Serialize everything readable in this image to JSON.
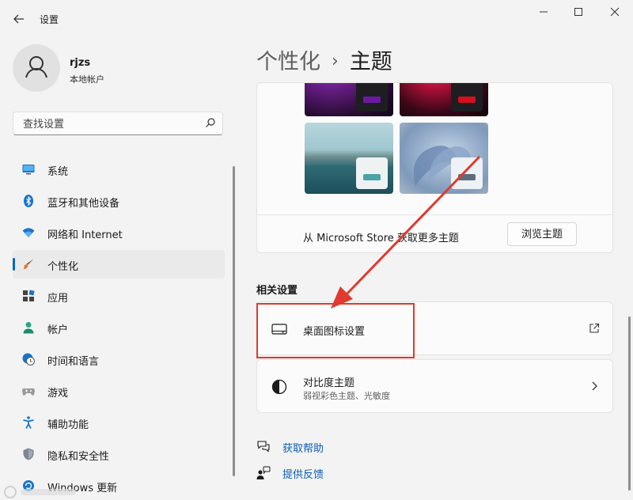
{
  "window": {
    "title": "设置",
    "controls": {
      "minimize": "—",
      "maximize": "☐",
      "close": "✕"
    }
  },
  "profile": {
    "username": "rjzs",
    "account_type": "本地帐户"
  },
  "search": {
    "placeholder": "查找设置"
  },
  "sidebar": {
    "items": [
      {
        "label": "系统",
        "icon": "monitor-icon"
      },
      {
        "label": "蓝牙和其他设备",
        "icon": "bluetooth-icon"
      },
      {
        "label": "网络和 Internet",
        "icon": "wifi-icon"
      },
      {
        "label": "个性化",
        "icon": "brush-icon",
        "selected": true
      },
      {
        "label": "应用",
        "icon": "apps-icon"
      },
      {
        "label": "帐户",
        "icon": "person-icon"
      },
      {
        "label": "时间和语言",
        "icon": "globe-clock-icon"
      },
      {
        "label": "游戏",
        "icon": "gamepad-icon"
      },
      {
        "label": "辅助功能",
        "icon": "accessibility-icon"
      },
      {
        "label": "隐私和安全性",
        "icon": "shield-icon"
      },
      {
        "label": "Windows 更新",
        "icon": "update-icon"
      }
    ]
  },
  "header": {
    "parent": "个性化",
    "separator": "›",
    "current": "主题"
  },
  "themes": {
    "store_text": "从 Microsoft Store 获取更多主题",
    "browse_label": "浏览主题"
  },
  "related": {
    "heading": "相关设置",
    "desktop_icons": {
      "title": "桌面图标设置",
      "trail_icon": "external-link-icon"
    },
    "contrast": {
      "title": "对比度主题",
      "subtitle": "弱视彩色主题、光敏度",
      "trail_icon": "chevron-right-icon"
    }
  },
  "help": {
    "get_help": "获取帮助",
    "feedback": "提供反馈"
  },
  "colors": {
    "accent": "#0067c0",
    "annotation_red": "#e03a2e"
  }
}
